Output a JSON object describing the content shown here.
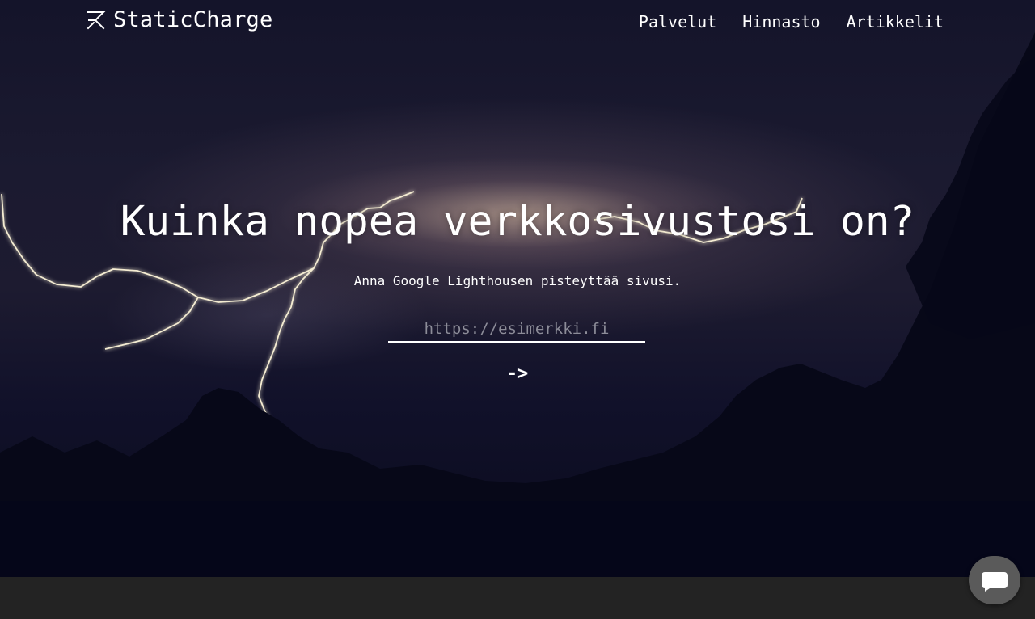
{
  "brand": {
    "name": "StaticCharge",
    "logo_icon": "staticcharge-logo-icon"
  },
  "nav": {
    "items": [
      {
        "label": "Palvelut"
      },
      {
        "label": "Hinnasto"
      },
      {
        "label": "Artikkelit"
      }
    ]
  },
  "hero": {
    "headline": "Kuinka nopea verkkosivustosi on?",
    "subtitle": "Anna Google Lighthousen pisteyttää sivusi.",
    "url_input": {
      "placeholder": "https://esimerkki.fi",
      "value": ""
    },
    "submit_label": "->",
    "background": "lightning-storm-photo"
  },
  "chat": {
    "icon": "chat-bubble-icon"
  },
  "colors": {
    "text": "#ffffff",
    "footer": "#232323",
    "chat_button": "#5a5a5a"
  }
}
